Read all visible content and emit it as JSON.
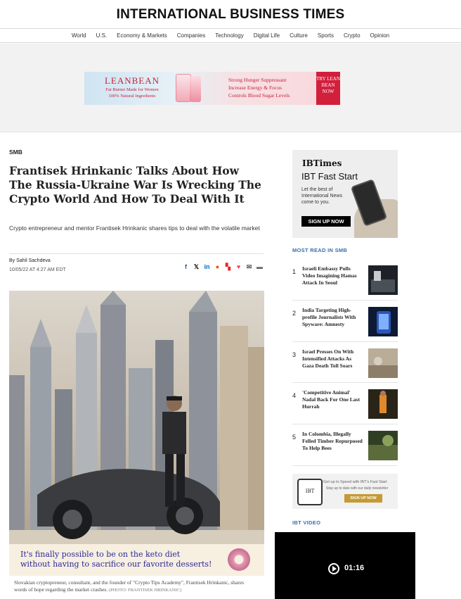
{
  "site": {
    "title": "INTERNATIONAL BUSINESS TIMES"
  },
  "nav": [
    "World",
    "U.S.",
    "Economy & Markets",
    "Companies",
    "Technology",
    "Digital Life",
    "Culture",
    "Sports",
    "Crypto",
    "Opinion"
  ],
  "top_ad": {
    "brand": "LEANBEAN",
    "tagline1": "Fat Burner Made for Women",
    "tagline2": "100% Natural Ingredients",
    "benefits": [
      "Strong Hunger Suppressant",
      "Increase Energy & Focus",
      "Controls Blood Sugar Levels"
    ],
    "cta": "TRY LEAN BEAN NOW"
  },
  "article": {
    "section": "SMB",
    "headline": "Frantisek Hrinkanic Talks About How The Russia-Ukraine War Is Wrecking The Crypto World And How To Deal With It",
    "summary": "Crypto entrepreneur and mentor Frantisek Hrinkanic shares tips to deal with the volatile market",
    "author": "By Sahil Sachdeva",
    "date": "10/05/22 AT 4:27 AM EDT",
    "share_icons": [
      "facebook-icon",
      "x-icon",
      "linkedin-icon",
      "reddit-icon",
      "flipboard-icon",
      "pocket-icon",
      "email-icon",
      "comment-icon"
    ],
    "caption": "Slovakian cryptopreneur, consultant, and the founder of \"Crypto Tips Academy\", Frantisek Hrinkanic, shares words of hope regarding the market crashes.",
    "photo_credit": "(PHOTO: FRANTISEK HRINKANIC)"
  },
  "inline_ad": {
    "line1": "It's finally possible to be on the keto diet",
    "line2": "without having to sacrifice our favorite desserts!"
  },
  "sidebar_ad": {
    "brand": "IBTimes",
    "title": "IBT Fast Start",
    "desc": "Let the best of International News come to you.",
    "button": "SIGN UP NOW"
  },
  "most_read": {
    "label": "MOST READ IN SMB",
    "items": [
      {
        "num": "1",
        "title": "Israeli Embassy Pulls Video Imagining Hamas Attack In Seoul"
      },
      {
        "num": "2",
        "title": "India Targeting High-profile Journalists With Spyware: Amnesty"
      },
      {
        "num": "3",
        "title": "Israel Presses On With Intensified Attacks As Gaza Death Toll Soars"
      },
      {
        "num": "4",
        "title": "'Competitive Animal' Nadal Back For One Last Hurrah"
      },
      {
        "num": "5",
        "title": "In Colombia, Illegally Felled Timber Repurposed To Help Bees"
      }
    ]
  },
  "fast_start": {
    "device_label": "IBT",
    "line1": "Get up to Speed with IBT's Fast Start",
    "line2": "Stay up to date with our daily newsletter",
    "button": "SIGN UP NOW"
  },
  "video": {
    "label": "IBT VIDEO",
    "duration": "01:16"
  }
}
